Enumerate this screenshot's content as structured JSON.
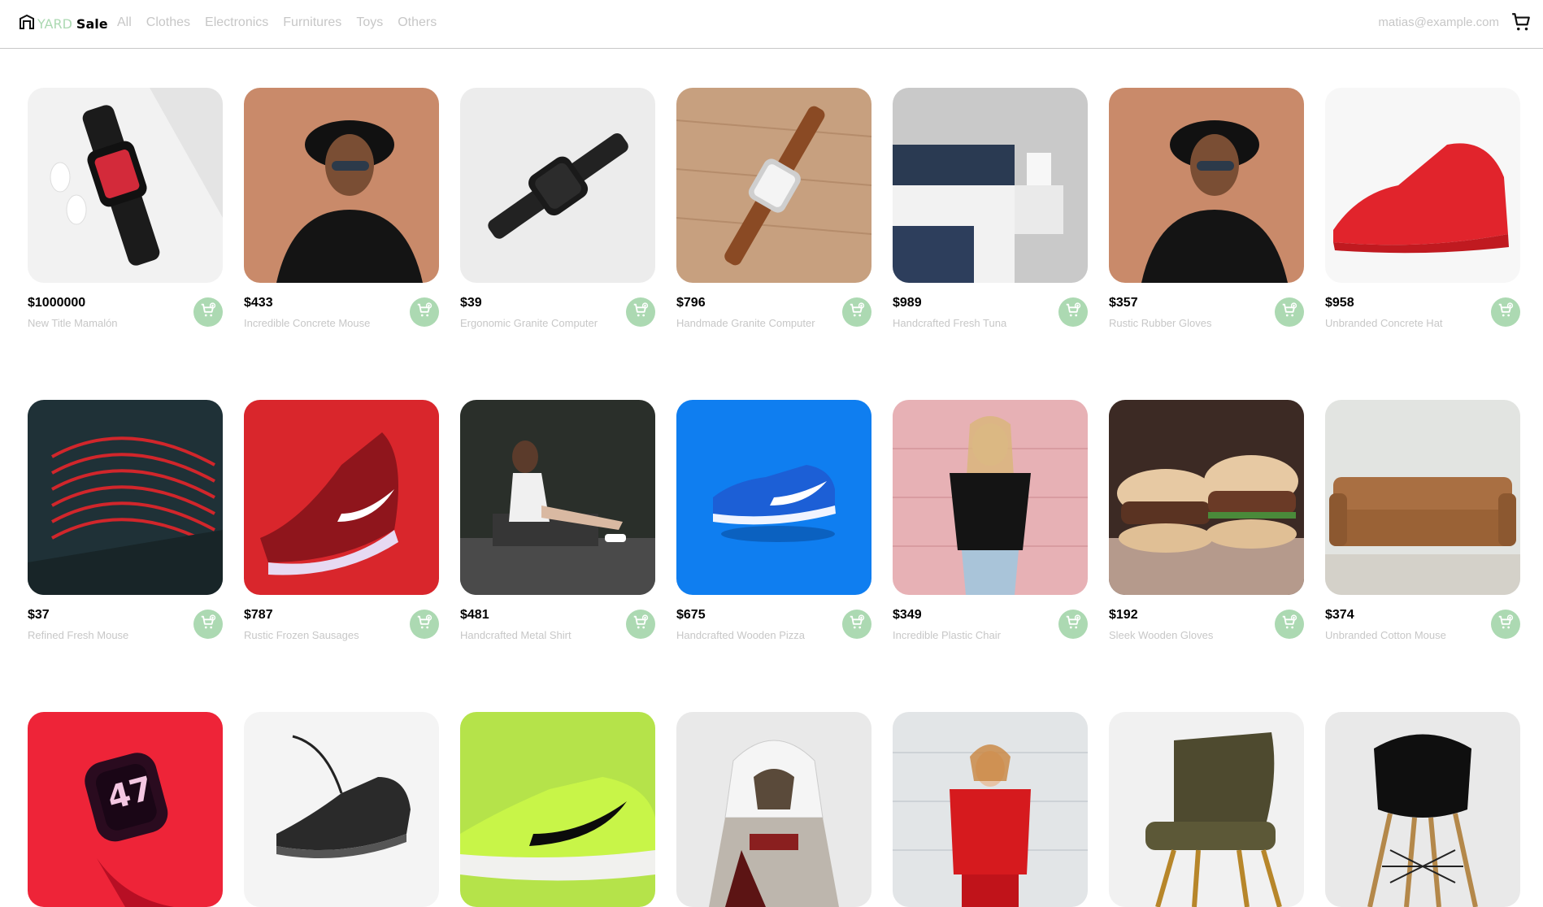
{
  "brand": {
    "yard": "YARD",
    "sale": "Sale"
  },
  "nav": [
    "All",
    "Clothes",
    "Electronics",
    "Furnitures",
    "Toys",
    "Others"
  ],
  "account": {
    "email": "matias@example.com"
  },
  "colors": {
    "accent": "#acd9b2",
    "muted": "#c7c7c7",
    "border": "#c8c8c8"
  },
  "products": [
    {
      "price": "$1000000",
      "title": "New Title Mamalón",
      "art": "watch-airpods"
    },
    {
      "price": "$433",
      "title": "Incredible Concrete Mouse",
      "art": "man-hat"
    },
    {
      "price": "$39",
      "title": "Ergonomic Granite Computer",
      "art": "black-watch"
    },
    {
      "price": "$796",
      "title": "Handmade Granite Computer",
      "art": "leather-watch"
    },
    {
      "price": "$989",
      "title": "Handcrafted Fresh Tuna",
      "art": "bedroom"
    },
    {
      "price": "$357",
      "title": "Rustic Rubber Gloves",
      "art": "man-hat"
    },
    {
      "price": "$958",
      "title": "Unbranded Concrete Hat",
      "art": "red-sneaker"
    },
    {
      "price": "$37",
      "title": "Refined Fresh Mouse",
      "art": "red-chair-wire"
    },
    {
      "price": "$787",
      "title": "Rustic Frozen Sausages",
      "art": "red-nike"
    },
    {
      "price": "$481",
      "title": "Handcrafted Metal Shirt",
      "art": "woman-sitting"
    },
    {
      "price": "$675",
      "title": "Handcrafted Wooden Pizza",
      "art": "blue-nike"
    },
    {
      "price": "$349",
      "title": "Incredible Plastic Chair",
      "art": "woman-pink-wall"
    },
    {
      "price": "$192",
      "title": "Sleek Wooden Gloves",
      "art": "burgers"
    },
    {
      "price": "$374",
      "title": "Unbranded Cotton Mouse",
      "art": "sofa"
    },
    {
      "price": "",
      "title": "",
      "art": "red-watch"
    },
    {
      "price": "",
      "title": "",
      "art": "black-sneaker"
    },
    {
      "price": "",
      "title": "",
      "art": "green-nike"
    },
    {
      "price": "",
      "title": "",
      "art": "assassin"
    },
    {
      "price": "",
      "title": "",
      "art": "woman-red-sweater"
    },
    {
      "price": "",
      "title": "",
      "art": "green-chair"
    },
    {
      "price": "",
      "title": "",
      "art": "black-stool"
    }
  ]
}
